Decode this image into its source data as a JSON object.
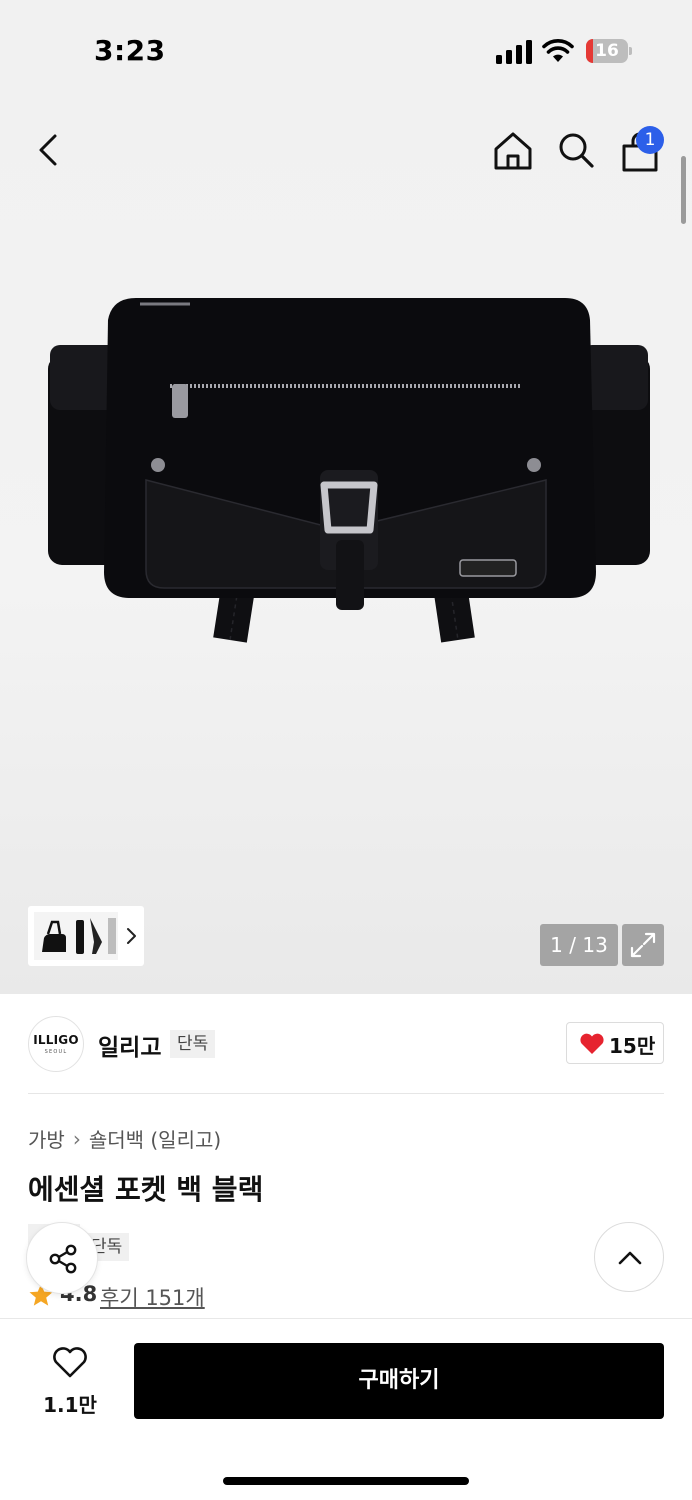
{
  "status_bar": {
    "time": "3:23",
    "battery_level": "16",
    "battery_fraction": 0.16
  },
  "header": {
    "back_icon": "chevron-left-icon",
    "home_icon": "home-icon",
    "search_icon": "search-icon",
    "cart_icon": "shopping-bag-icon",
    "cart_count": "1",
    "badge_color": "#2c5fe9"
  },
  "gallery": {
    "current": "1 / 13",
    "expand_icon": "expand-icon"
  },
  "brand": {
    "logo_text": "ILLIGO",
    "logo_subtext": "SEOUL",
    "name": "일리고",
    "tag": "단독",
    "likes": "15만",
    "heart_color": "#e6232f"
  },
  "product": {
    "breadcrumb": [
      "가방",
      "숄더백 (일리고)"
    ],
    "title": "에센셜 포켓 백 블랙",
    "tags": [
      "",
      "단독"
    ],
    "rating": "4.8",
    "reviews": "후기 151개",
    "star_color": "#f5a623"
  },
  "bottom_bar": {
    "wish_count": "1.1만",
    "buy_label": "구매하기"
  }
}
